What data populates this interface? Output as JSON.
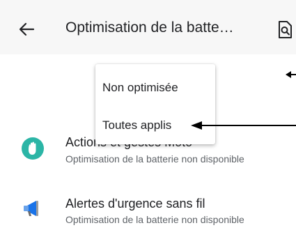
{
  "header": {
    "title": "Optimisation de la batte…",
    "back_icon": "arrow-back-icon",
    "search_icon": "document-search-icon"
  },
  "dropdown": {
    "items": [
      {
        "label": "Non optimisée"
      },
      {
        "label": "Toutes applis"
      }
    ]
  },
  "apps": [
    {
      "name": "Actions et gestes Moto",
      "status": "Optimisation de la batterie non disponible",
      "icon": "hand-wave-icon",
      "icon_color": "#2bb5a6"
    },
    {
      "name": "Alertes d'urgence sans fil",
      "status": "Optimisation de la batterie non disponible",
      "icon": "megaphone-icon",
      "icon_color": "#1a73e8"
    }
  ]
}
